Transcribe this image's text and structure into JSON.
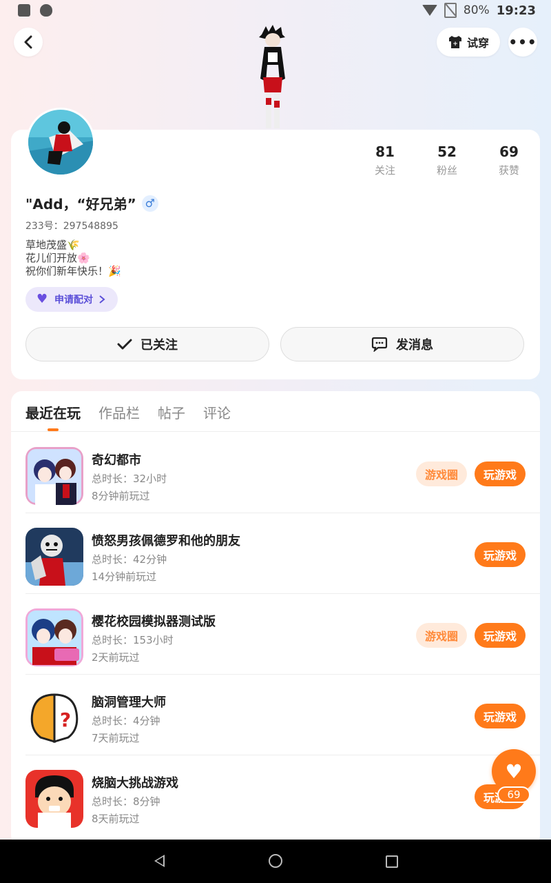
{
  "status_bar": {
    "battery": "80%",
    "time": "19:23"
  },
  "header": {
    "try_on_label": "试穿",
    "more_label": "•••"
  },
  "profile": {
    "stats": [
      {
        "value": "81",
        "label": "关注"
      },
      {
        "value": "52",
        "label": "粉丝"
      },
      {
        "value": "69",
        "label": "获赞"
      }
    ],
    "name": "\"Add，“好兄弟”",
    "gender_symbol": "♂",
    "uid": "233号：297548895",
    "bio": [
      "草地茂盛🌾",
      "花儿们开放🌸",
      "祝你们新年快乐！🎉"
    ],
    "pair_label": "申请配对",
    "follow_label": "已关注",
    "message_label": "发消息"
  },
  "tabs": [
    "最近在玩",
    "作品栏",
    "帖子",
    "评论"
  ],
  "games": [
    {
      "title": "奇幻都市",
      "duration": "总时长：32小时",
      "last_played": "8分钟前玩过",
      "has_circle": true
    },
    {
      "title": "愤怒男孩佩德罗和他的朋友",
      "duration": "总时长：42分钟",
      "last_played": "14分钟前玩过",
      "has_circle": false
    },
    {
      "title": "樱花校园模拟器测试版",
      "duration": "总时长：153小时",
      "last_played": "2天前玩过",
      "has_circle": true
    },
    {
      "title": "脑洞管理大师",
      "duration": "总时长：4分钟",
      "last_played": "7天前玩过",
      "has_circle": false
    },
    {
      "title": "烧脑大挑战游戏",
      "duration": "总时长：8分钟",
      "last_played": "8天前玩过",
      "has_circle": false
    }
  ],
  "game_buttons": {
    "circle_label": "游戏圈",
    "play_label": "玩游戏"
  },
  "fab": {
    "count": "69"
  },
  "colors": {
    "accent": "#ff7a1a",
    "accent_light": "#ffeadb",
    "pair_bg": "#ece8fb",
    "pair_text": "#5b4fd8"
  }
}
